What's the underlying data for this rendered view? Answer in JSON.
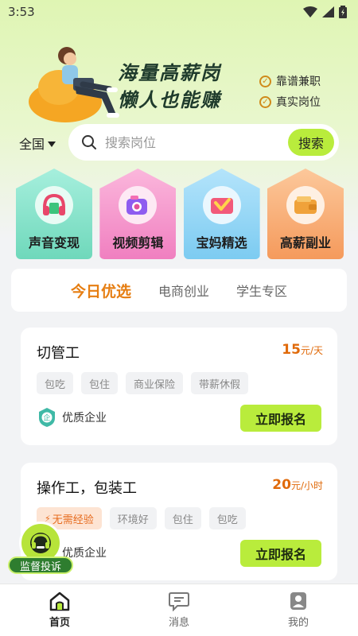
{
  "status_bar": {
    "time": "3:53",
    "icons": [
      "wifi-icon",
      "signal-icon",
      "battery-icon"
    ]
  },
  "banner": {
    "slogan_line1": "海量高薪岗",
    "slogan_line2": "懒人也能赚",
    "features": [
      "靠谱兼职",
      "真实岗位"
    ]
  },
  "search": {
    "region": "全国",
    "placeholder": "搜索岗位",
    "button": "搜索"
  },
  "categories": [
    {
      "label": "声音变现",
      "icon": "headphones-icon",
      "color": "#7fe0c4"
    },
    {
      "label": "视频剪辑",
      "icon": "camera-icon",
      "color": "#f59fce"
    },
    {
      "label": "宝妈精选",
      "icon": "checkmark-icon",
      "color": "#8ed4f5"
    },
    {
      "label": "高薪副业",
      "icon": "wallet-icon",
      "color": "#fbb27a"
    }
  ],
  "tabs": [
    {
      "label": "今日优选",
      "active": true
    },
    {
      "label": "电商创业",
      "active": false
    },
    {
      "label": "学生专区",
      "active": false
    }
  ],
  "jobs": [
    {
      "title": "切管工",
      "salary": "15",
      "unit": "元/天",
      "tags": [
        "包吃",
        "包住",
        "商业保险",
        "带薪休假"
      ],
      "company": "优质企业",
      "apply": "立即报名"
    },
    {
      "title": "操作工，包装工",
      "salary": "20",
      "unit": "元/小时",
      "tags": [
        "无需经验",
        "环境好",
        "包住",
        "包吃"
      ],
      "company": "优质企业",
      "apply": "立即报名"
    }
  ],
  "complaint": {
    "label": "监督投诉"
  },
  "bottom_nav": [
    {
      "label": "首页",
      "icon": "home-icon",
      "active": true
    },
    {
      "label": "消息",
      "icon": "message-icon",
      "active": false
    },
    {
      "label": "我的",
      "icon": "profile-icon",
      "active": false
    }
  ],
  "colors": {
    "accent": "#b9ec3c",
    "salary": "#e06a0a",
    "tab_active": "#e67e12"
  }
}
